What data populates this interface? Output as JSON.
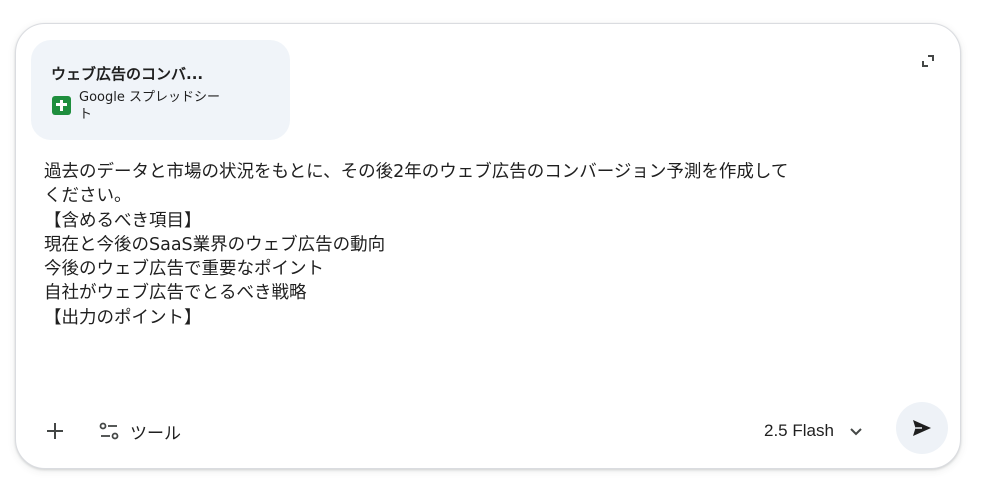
{
  "attachment": {
    "title": "ウェブ広告のコンバ...",
    "source": "Google スプレッドシート",
    "icon": "google-sheets-icon",
    "icon_color": "#1e8e3e"
  },
  "prompt": {
    "text": "過去のデータと市場の状況をもとに、その後2年のウェブ広告のコンバージョン予測を作成して\nください。\n【含めるべき項目】\n現在と今後のSaaS業界のウェブ広告の動向\n今後のウェブ広告で重要なポイント\n自社がウェブ広告でとるべき戦略\n【出力のポイント】"
  },
  "toolbar": {
    "add_icon": "plus-icon",
    "tools_icon": "tune-icon",
    "tools_label": "ツール",
    "model_label": "2.5 Flash",
    "model_icon": "chevron-down-icon",
    "send_icon": "send-icon",
    "expand_icon": "expand-icon"
  }
}
